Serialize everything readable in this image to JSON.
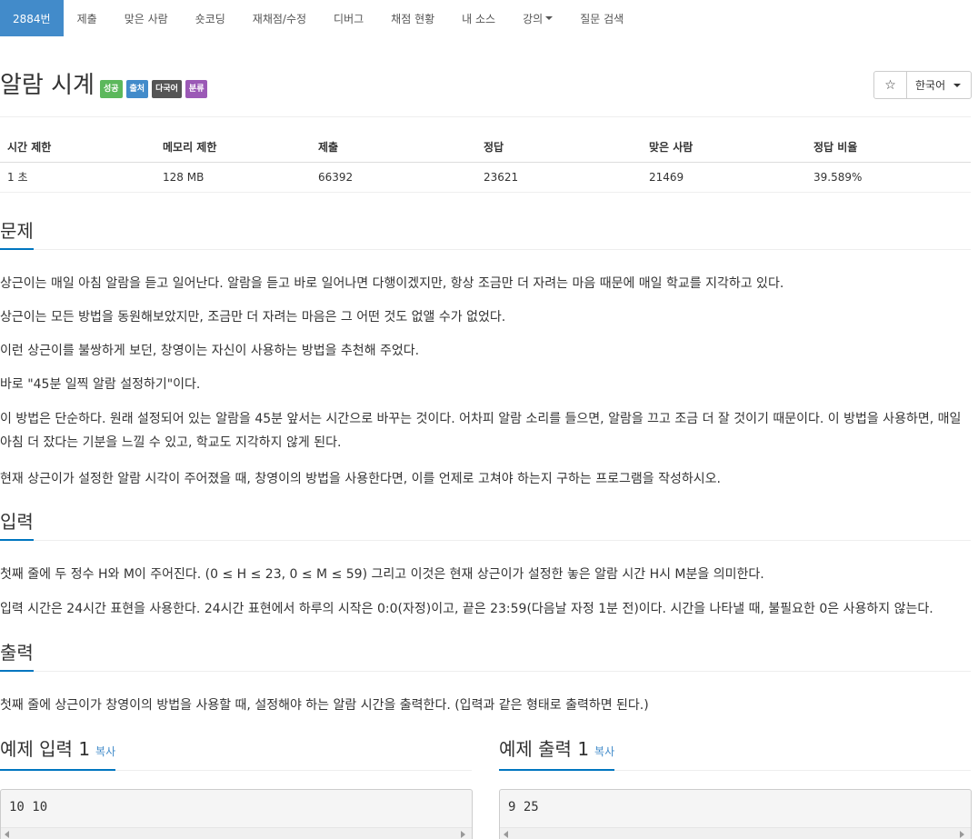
{
  "nav": {
    "items": [
      {
        "label": "2884번"
      },
      {
        "label": "제출"
      },
      {
        "label": "맞은 사람"
      },
      {
        "label": "숏코딩"
      },
      {
        "label": "재채점/수정"
      },
      {
        "label": "디버그"
      },
      {
        "label": "채점 현황"
      },
      {
        "label": "내 소스"
      },
      {
        "label": "강의"
      },
      {
        "label": "질문 검색"
      }
    ]
  },
  "problem": {
    "title": "알람 시계",
    "labels": [
      "성공",
      "출처",
      "다국어",
      "분류"
    ],
    "star": "☆",
    "language": "한국어"
  },
  "info": {
    "headers": [
      "시간 제한",
      "메모리 제한",
      "제출",
      "정답",
      "맞은 사람",
      "정답 비율"
    ],
    "values": [
      "1 초",
      "128 MB",
      "66392",
      "23621",
      "21469",
      "39.589%"
    ]
  },
  "description": {
    "heading": "문제",
    "p1": "상근이는 매일 아침 알람을 듣고 일어난다. 알람을 듣고 바로 일어나면 다행이겠지만, 항상 조금만 더 자려는 마음 때문에 매일 학교를 지각하고 있다.",
    "p2": "상근이는 모든 방법을 동원해보았지만, 조금만 더 자려는 마음은 그 어떤 것도 없앨 수가 없었다.",
    "p3": "이런 상근이를 불쌍하게 보던, 창영이는 자신이 사용하는 방법을 추천해 주었다.",
    "p4": "바로 \"45분 일찍 알람 설정하기\"이다.",
    "p5": "이 방법은 단순하다. 원래 설정되어 있는 알람을 45분 앞서는 시간으로 바꾸는 것이다. 어차피 알람 소리를 들으면, 알람을 끄고 조금 더 잘 것이기 때문이다. 이 방법을 사용하면, 매일 아침 더 잤다는 기분을 느낄 수 있고, 학교도 지각하지 않게 된다.",
    "p6": "현재 상근이가 설정한 알람 시각이 주어졌을 때, 창영이의 방법을 사용한다면, 이를 언제로 고쳐야 하는지 구하는 프로그램을 작성하시오."
  },
  "input": {
    "heading": "입력",
    "p1": "첫째 줄에 두 정수 H와 M이 주어진다. (0 ≤ H ≤ 23, 0 ≤ M ≤ 59) 그리고 이것은 현재 상근이가 설정한 놓은 알람 시간 H시 M분을 의미한다.",
    "p2": "입력 시간은 24시간 표현을 사용한다. 24시간 표현에서 하루의 시작은 0:0(자정)이고, 끝은 23:59(다음날 자정 1분 전)이다. 시간을 나타낼 때, 불필요한 0은 사용하지 않는다."
  },
  "output": {
    "heading": "출력",
    "p1": "첫째 줄에 상근이가 창영이의 방법을 사용할 때, 설정해야 하는 알람 시간을 출력한다. (입력과 같은 형태로 출력하면 된다.)"
  },
  "samples": {
    "input_heading": "예제 입력 1",
    "output_heading": "예제 출력 1",
    "copy_label": "복사",
    "input_text": "10 10",
    "output_text": "9 25"
  }
}
